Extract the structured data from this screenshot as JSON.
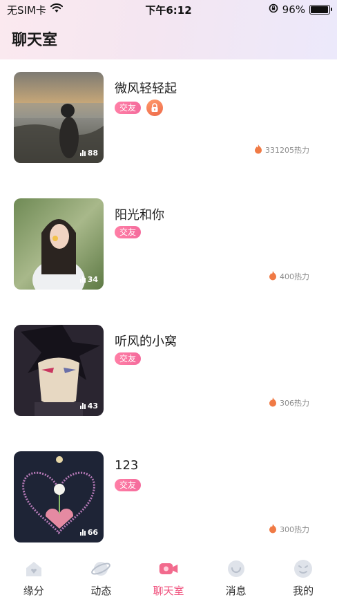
{
  "status_bar": {
    "carrier": "无SIM卡",
    "time": "下午6:12",
    "battery": "96%",
    "battery_level": 0.96
  },
  "header": {
    "title": "聊天室"
  },
  "rooms": [
    {
      "name": "微风轻轻起",
      "tag": "交友",
      "locked": true,
      "online": "88",
      "heat": "331205热力"
    },
    {
      "name": "阳光和你",
      "tag": "交友",
      "locked": false,
      "online": "34",
      "heat": "400热力"
    },
    {
      "name": "听风的小窝",
      "tag": "交友",
      "locked": false,
      "online": "43",
      "heat": "306热力"
    },
    {
      "name": "123",
      "tag": "交友",
      "locked": false,
      "online": "66",
      "heat": "300热力"
    }
  ],
  "tabbar": {
    "items": [
      {
        "label": "缘分",
        "icon": "home-icon"
      },
      {
        "label": "动态",
        "icon": "planet-icon"
      },
      {
        "label": "聊天室",
        "icon": "video-icon",
        "active": true
      },
      {
        "label": "消息",
        "icon": "message-icon"
      },
      {
        "label": "我的",
        "icon": "profile-icon"
      }
    ]
  },
  "colors": {
    "accent": "#f0527e",
    "tag": "#f46b9c",
    "header_bg": "#f4e6f1"
  }
}
